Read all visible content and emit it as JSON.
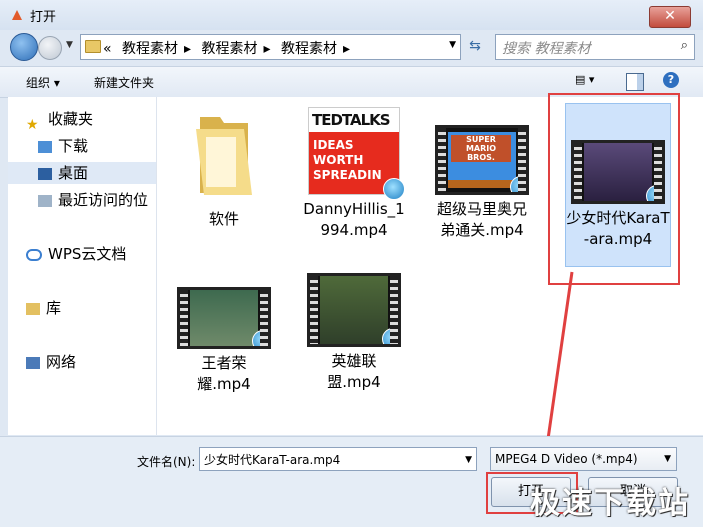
{
  "window": {
    "title": "打开",
    "close_label": "✕"
  },
  "nav": {
    "breadcrumb_prefix": "«",
    "breadcrumbs": [
      "教程素材",
      "教程素材",
      "教程素材"
    ],
    "search_placeholder": "搜索 教程素材"
  },
  "toolbar": {
    "organize": "组织 ▾",
    "new_folder": "新建文件夹",
    "help": "?"
  },
  "sidebar": {
    "favorites": "收藏夹",
    "download": "下载",
    "desktop": "桌面",
    "recent": "最近访问的位",
    "wps": "WPS云文档",
    "library": "库",
    "network": "网络"
  },
  "files": [
    {
      "label": "软件"
    },
    {
      "label": "DannyHillis_1994.mp4"
    },
    {
      "label": "超级马里奥兄弟通关.mp4"
    },
    {
      "label": "少女时代KaraT-ara.mp4"
    },
    {
      "label": "王者荣耀.mp4"
    },
    {
      "label": "英雄联盟.mp4"
    }
  ],
  "thumbs": {
    "ted_top": "TEDTALKS",
    "ted_bottom": "IDEAS WORTH SPREADIN",
    "mario": "SUPER MARIO BROS."
  },
  "bottom": {
    "filename_label": "文件名(N):",
    "filename_value": "少女时代KaraT-ara.mp4",
    "filter_value": "MPEG4   D Video (*.mp4)",
    "open_button": "打开",
    "cancel_button": "取消"
  },
  "watermark": "极速下载站",
  "colors": {
    "highlight": "#e04040",
    "selection": "#cfe3fb"
  }
}
